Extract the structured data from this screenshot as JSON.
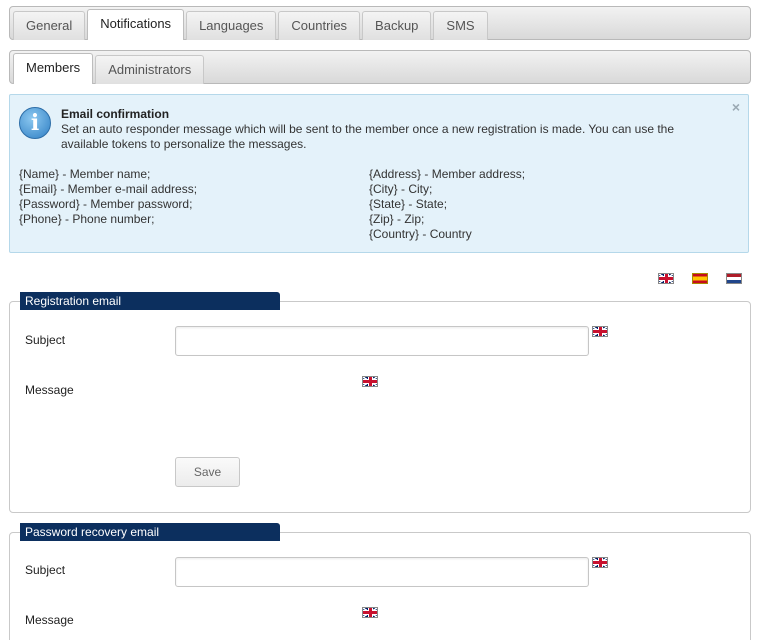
{
  "main_tabs": [
    {
      "label": "General",
      "active": false
    },
    {
      "label": "Notifications",
      "active": true
    },
    {
      "label": "Languages",
      "active": false
    },
    {
      "label": "Countries",
      "active": false
    },
    {
      "label": "Backup",
      "active": false
    },
    {
      "label": "SMS",
      "active": false
    }
  ],
  "sub_tabs": [
    {
      "label": "Members",
      "active": true
    },
    {
      "label": "Administrators",
      "active": false
    }
  ],
  "info_box": {
    "icon": "info-icon",
    "title": "Email confirmation",
    "description": "Set an auto responder message which will be sent to the member once a new registration is made. You can use the available tokens to personalize the messages.",
    "close": "×",
    "tokens_left": [
      "{Name} - Member name;",
      "{Email} - Member e-mail address;",
      "{Password} - Member password;",
      "{Phone} - Phone number;"
    ],
    "tokens_right": [
      "{Address} - Member address;",
      "{City} - City;",
      "{State} - State;",
      "{Zip} - Zip;",
      "{Country} - Country"
    ]
  },
  "language_flags": [
    "uk-flag-icon",
    "spain-flag-icon",
    "netherlands-flag-icon"
  ],
  "registration_email": {
    "title": "Registration email",
    "subject_label": "Subject",
    "subject_value": "",
    "message_label": "Message",
    "save_label": "Save"
  },
  "password_recovery_email": {
    "title": "Password recovery email",
    "subject_label": "Subject",
    "subject_value": "",
    "message_label": "Message"
  },
  "colors": {
    "panel_title_bg": "#0c2f5e",
    "info_bg": "#e4f2fa",
    "info_border": "#b5d8ea"
  }
}
